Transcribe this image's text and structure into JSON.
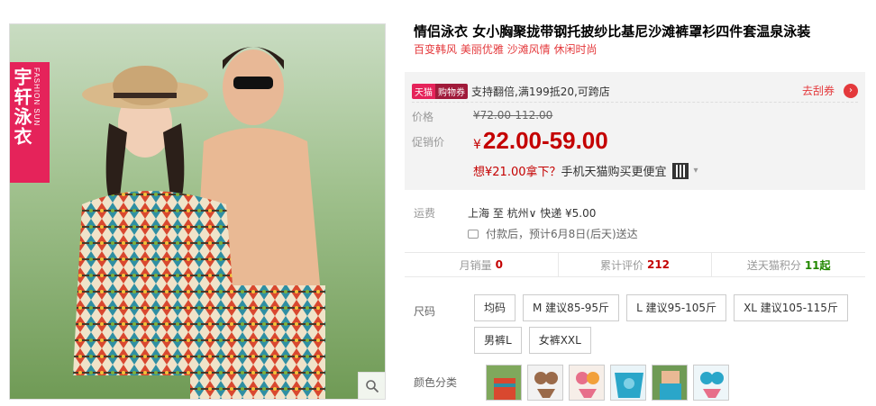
{
  "brand_badge": {
    "cn": "宇轩泳衣",
    "en": "FASHION SUN"
  },
  "product": {
    "title": "情侣泳衣 女小胸聚拢带钢托披纱比基尼沙滩裤罩衫四件套温泉泳装",
    "subtitle": "百变韩风 美丽优雅 沙滩风情 休闲时尚"
  },
  "promo": {
    "tag_tmall": "天猫",
    "tag_coupon": "购物券",
    "text": "支持翻倍,满199抵20,可跨店",
    "coupon_link": "去刮券",
    "arrow": "›"
  },
  "price": {
    "orig_label": "价格",
    "orig_value": "¥72.00-112.00",
    "sale_label": "促销价",
    "yen": "¥",
    "sale_value": "22.00-59.00"
  },
  "mobile": {
    "prefix": "想",
    "amount": "¥21.00拿下？",
    "suffix": "手机天猫购买更便宜",
    "arrow": "▾"
  },
  "shipping": {
    "label": "运费",
    "route": "上海 至 杭州∨ 快递 ¥5.00",
    "eta": "付款后，预计6月8日(后天)送达"
  },
  "stats": [
    {
      "label": "月销量",
      "value": "0"
    },
    {
      "label": "累计评价",
      "value": "212"
    },
    {
      "label": "送天猫积分",
      "value": "11起"
    }
  ],
  "size": {
    "label": "尺码",
    "options": [
      "均码",
      "M 建议85-95斤",
      "L 建议95-105斤",
      "XL 建议105-115斤",
      "男裤L",
      "女裤XXL"
    ]
  },
  "color": {
    "label": "颜色分类"
  },
  "icons": {
    "zoom": "magnifier-icon",
    "truck": "truck-icon",
    "qr": "qr-code-icon"
  },
  "colors": {
    "accent": "#c40000",
    "brand": "#e5235a"
  }
}
